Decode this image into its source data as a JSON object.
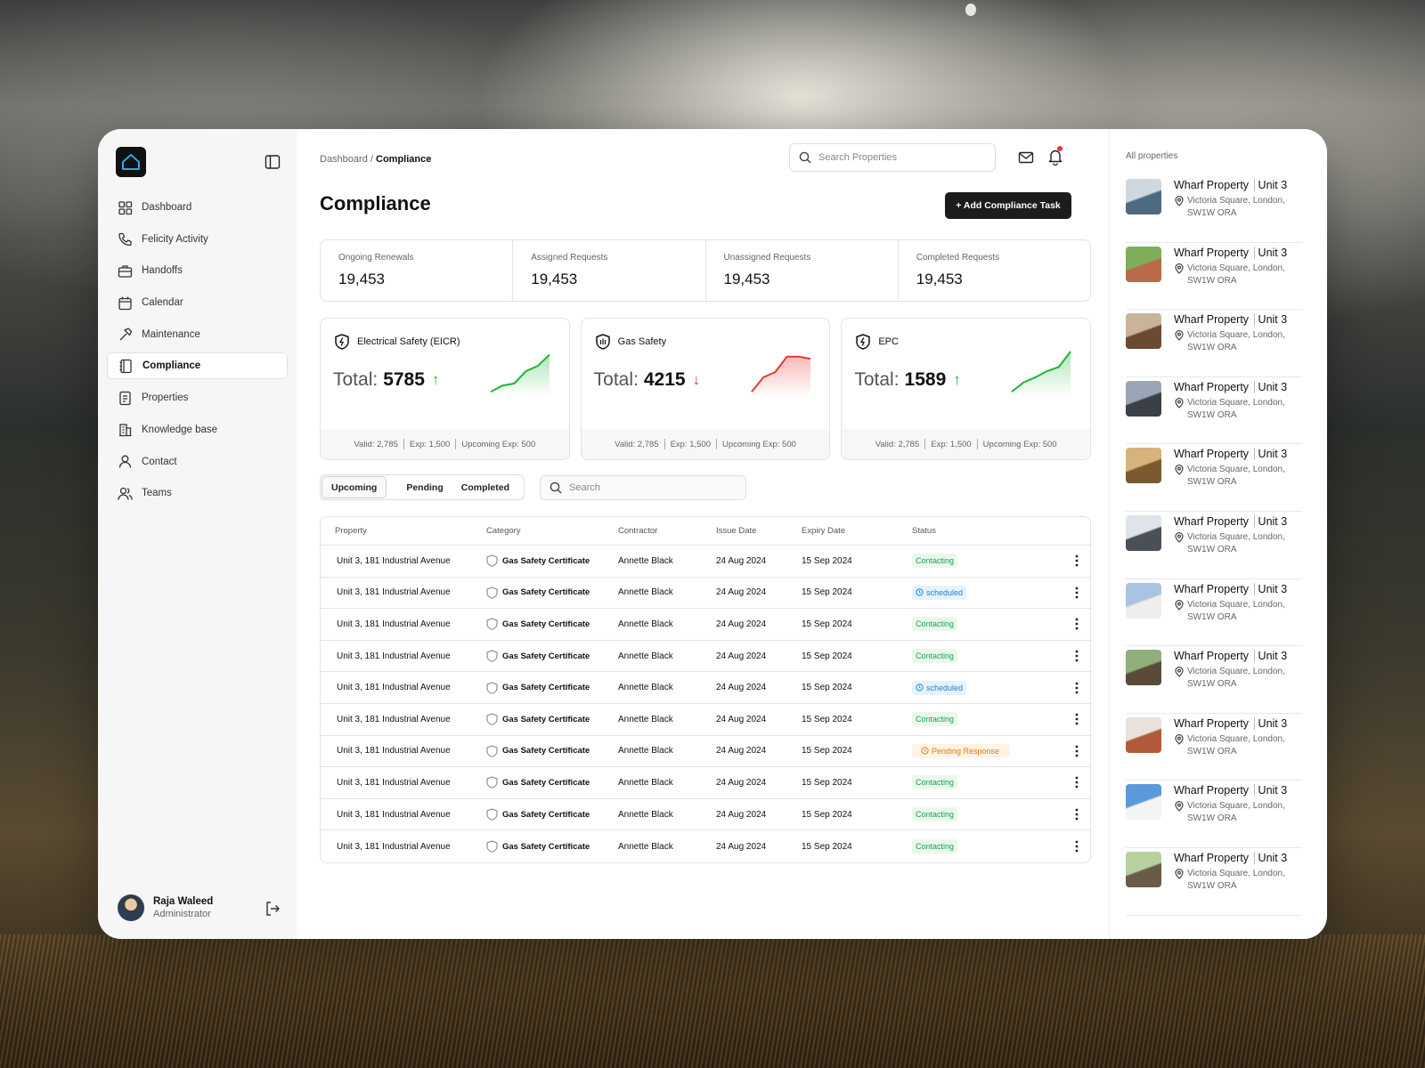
{
  "sidebar": {
    "items": [
      {
        "label": "Dashboard",
        "icon": "grid-icon"
      },
      {
        "label": "Felicity Activity",
        "icon": "phone-icon"
      },
      {
        "label": "Handoffs",
        "icon": "briefcase-icon"
      },
      {
        "label": "Calendar",
        "icon": "calendar-icon"
      },
      {
        "label": "Maintenance",
        "icon": "hammer-icon"
      },
      {
        "label": "Compliance",
        "icon": "notebook-icon"
      },
      {
        "label": "Properties",
        "icon": "document-icon"
      },
      {
        "label": "Knowledge base",
        "icon": "building-icon"
      },
      {
        "label": "Contact",
        "icon": "user-icon"
      },
      {
        "label": "Teams",
        "icon": "users-icon"
      }
    ],
    "user": {
      "name": "Raja Waleed",
      "role": "Administrator"
    }
  },
  "header": {
    "breadcrumb_root": "Dashboard",
    "breadcrumb_sep": " / ",
    "breadcrumb_current": "Compliance",
    "search_placeholder": "Search Properties"
  },
  "page": {
    "title": "Compliance",
    "add_button": "+ Add Compliance Task"
  },
  "stats": [
    {
      "label": "Ongoing Renewals",
      "value": "19,453"
    },
    {
      "label": "Assigned Requests",
      "value": "19,453"
    },
    {
      "label": "Unassigned Requests",
      "value": "19,453"
    },
    {
      "label": "Completed Requests",
      "value": "19,453"
    }
  ],
  "cards": [
    {
      "title": "Electrical Safety (EICR)",
      "total_label": "Total:",
      "total": "5785",
      "arrow": "↑",
      "trend": "up",
      "valid": "Valid: 2,785",
      "exp": "Exp: 1,500",
      "upcoming": "Upcoming Exp: 500",
      "spark": [
        10,
        22,
        26,
        50,
        60,
        82
      ]
    },
    {
      "title": "Gas Safety",
      "total_label": "Total:",
      "total": "4215",
      "arrow": "↓",
      "trend": "down",
      "valid": "Valid: 2,785",
      "exp": "Exp: 1,500",
      "upcoming": "Upcoming Exp: 500",
      "spark": [
        10,
        38,
        48,
        78,
        78,
        74
      ]
    },
    {
      "title": "EPC",
      "total_label": "Total:",
      "total": "1589",
      "arrow": "↑",
      "trend": "up",
      "valid": "Valid: 2,785",
      "exp": "Exp: 1,500",
      "upcoming": "Upcoming Exp: 500",
      "spark": [
        10,
        28,
        38,
        50,
        58,
        88
      ]
    }
  ],
  "colors": {
    "up": "#1fb53a",
    "down": "#e53935"
  },
  "tabs": [
    "Upcoming",
    "Pending",
    "Completed"
  ],
  "table": {
    "search_placeholder": "Search",
    "headers": [
      "Property",
      "Category",
      "Contractor",
      "Issue Date",
      "Expiry Date",
      "Status"
    ],
    "rows": [
      {
        "property": "Unit 3, 181 Industrial Avenue",
        "category": "Gas Safety Certificate",
        "contractor": "Annette Black",
        "issue": "24 Aug 2024",
        "expiry": "15 Sep 2024",
        "status": "Contacting",
        "status_type": "contacting"
      },
      {
        "property": "Unit 3, 181 Industrial Avenue",
        "category": "Gas Safety Certificate",
        "contractor": "Annette Black",
        "issue": "24 Aug 2024",
        "expiry": "15 Sep 2024",
        "status": "scheduled",
        "status_type": "scheduled"
      },
      {
        "property": "Unit 3, 181 Industrial Avenue",
        "category": "Gas Safety Certificate",
        "contractor": "Annette Black",
        "issue": "24 Aug 2024",
        "expiry": "15 Sep 2024",
        "status": "Contacting",
        "status_type": "contacting"
      },
      {
        "property": "Unit 3, 181 Industrial Avenue",
        "category": "Gas Safety Certificate",
        "contractor": "Annette Black",
        "issue": "24 Aug 2024",
        "expiry": "15 Sep 2024",
        "status": "Contacting",
        "status_type": "contacting"
      },
      {
        "property": "Unit 3, 181 Industrial Avenue",
        "category": "Gas Safety Certificate",
        "contractor": "Annette Black",
        "issue": "24 Aug 2024",
        "expiry": "15 Sep 2024",
        "status": "scheduled",
        "status_type": "scheduled"
      },
      {
        "property": "Unit 3, 181 Industrial Avenue",
        "category": "Gas Safety Certificate",
        "contractor": "Annette Black",
        "issue": "24 Aug 2024",
        "expiry": "15 Sep 2024",
        "status": "Contacting",
        "status_type": "contacting"
      },
      {
        "property": "Unit 3, 181 Industrial Avenue",
        "category": "Gas Safety Certificate",
        "contractor": "Annette Black",
        "issue": "24 Aug 2024",
        "expiry": "15 Sep 2024",
        "status": "Pending Response",
        "status_type": "pending"
      },
      {
        "property": "Unit 3, 181 Industrial Avenue",
        "category": "Gas Safety Certificate",
        "contractor": "Annette Black",
        "issue": "24 Aug 2024",
        "expiry": "15 Sep 2024",
        "status": "Contacting",
        "status_type": "contacting"
      },
      {
        "property": "Unit 3, 181 Industrial Avenue",
        "category": "Gas Safety Certificate",
        "contractor": "Annette Black",
        "issue": "24 Aug 2024",
        "expiry": "15 Sep 2024",
        "status": "Contacting",
        "status_type": "contacting"
      },
      {
        "property": "Unit 3, 181 Industrial Avenue",
        "category": "Gas Safety Certificate",
        "contractor": "Annette Black",
        "issue": "24 Aug 2024",
        "expiry": "15 Sep 2024",
        "status": "Contacting",
        "status_type": "contacting"
      }
    ]
  },
  "right_panel": {
    "title": "All properties",
    "properties": [
      {
        "name": "Wharf Property",
        "unit": "Unit 3",
        "address": "Victoria Square, London, SW1W ORA",
        "thumb": [
          "#cfd8e0",
          "#4c6a82"
        ]
      },
      {
        "name": "Wharf Property",
        "unit": "Unit 3",
        "address": "Victoria Square, London, SW1W ORA",
        "thumb": [
          "#7fae5a",
          "#b86a4a"
        ]
      },
      {
        "name": "Wharf Property",
        "unit": "Unit 3",
        "address": "Victoria Square, London, SW1W ORA",
        "thumb": [
          "#c9b39a",
          "#6a4a33"
        ]
      },
      {
        "name": "Wharf Property",
        "unit": "Unit 3",
        "address": "Victoria Square, London, SW1W ORA",
        "thumb": [
          "#9aa6b5",
          "#3a3f48"
        ]
      },
      {
        "name": "Wharf Property",
        "unit": "Unit 3",
        "address": "Victoria Square, London, SW1W ORA",
        "thumb": [
          "#d7b27a",
          "#7a5a2e"
        ]
      },
      {
        "name": "Wharf Property",
        "unit": "Unit 3",
        "address": "Victoria Square, London, SW1W ORA",
        "thumb": [
          "#dfe4ea",
          "#4a4f58"
        ]
      },
      {
        "name": "Wharf Property",
        "unit": "Unit 3",
        "address": "Victoria Square, London, SW1W ORA",
        "thumb": [
          "#a8c4e0",
          "#eeeeee"
        ]
      },
      {
        "name": "Wharf Property",
        "unit": "Unit 3",
        "address": "Victoria Square, London, SW1W ORA",
        "thumb": [
          "#8fae7a",
          "#5a4a3a"
        ]
      },
      {
        "name": "Wharf Property",
        "unit": "Unit 3",
        "address": "Victoria Square, London, SW1W ORA",
        "thumb": [
          "#e8e2da",
          "#b05a3a"
        ]
      },
      {
        "name": "Wharf Property",
        "unit": "Unit 3",
        "address": "Victoria Square, London, SW1W ORA",
        "thumb": [
          "#5a9ad8",
          "#f4f4f4"
        ]
      },
      {
        "name": "Wharf Property",
        "unit": "Unit 3",
        "address": "Victoria Square, London, SW1W ORA",
        "thumb": [
          "#b8d0a0",
          "#6a5a48"
        ]
      }
    ]
  }
}
